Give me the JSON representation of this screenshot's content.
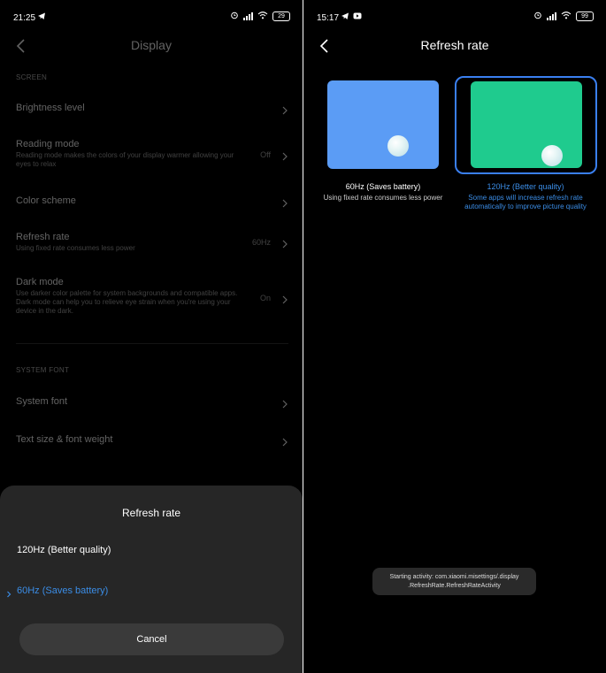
{
  "left": {
    "status": {
      "time": "21:25",
      "battery": "29"
    },
    "header": {
      "title": "Display"
    },
    "sections": {
      "screen": "SCREEN",
      "system_font": "SYSTEM FONT"
    },
    "rows": {
      "brightness": {
        "title": "Brightness level"
      },
      "reading": {
        "title": "Reading mode",
        "subtitle": "Reading mode makes the colors of your display warmer allowing your eyes to relax",
        "value": "Off"
      },
      "color": {
        "title": "Color scheme"
      },
      "refresh": {
        "title": "Refresh rate",
        "subtitle": "Using fixed rate consumes less power",
        "value": "60Hz"
      },
      "dark": {
        "title": "Dark mode",
        "subtitle": "Use darker color palette for system backgrounds and compatible apps. Dark mode can help you to relieve eye strain when you're using your device in the dark.",
        "value": "On"
      },
      "system_font": {
        "title": "System font"
      },
      "text_size": {
        "title": "Text size & font weight"
      }
    },
    "sheet": {
      "title": "Refresh rate",
      "options": [
        "120Hz (Better quality)",
        "60Hz (Saves battery)"
      ],
      "selected": "60Hz (Saves battery)",
      "cancel": "Cancel"
    }
  },
  "right": {
    "status": {
      "time": "15:17",
      "battery": "99"
    },
    "header": {
      "title": "Refresh rate"
    },
    "option_60": {
      "title": "60Hz (Saves battery)",
      "subtitle": "Using fixed rate consumes less power"
    },
    "option_120": {
      "title": "120Hz (Better quality)",
      "subtitle": "Some apps will increase refresh rate automatically to improve picture quality",
      "selected": true
    },
    "toast": {
      "line1": "Starting activity: com.xiaomi.misettings/.display",
      "line2": ".RefreshRate.RefreshRateActivity"
    }
  },
  "colors": {
    "accent": "#3b8de6",
    "preview_60": "#5b9cf5",
    "preview_120": "#1fcb8e",
    "sheet_bg": "#262626"
  },
  "icons": [
    "back-arrow-icon",
    "chevron-right-icon",
    "telegram-icon",
    "youtube-icon",
    "alarm-icon",
    "signal-icon",
    "wifi-icon",
    "battery-icon"
  ]
}
